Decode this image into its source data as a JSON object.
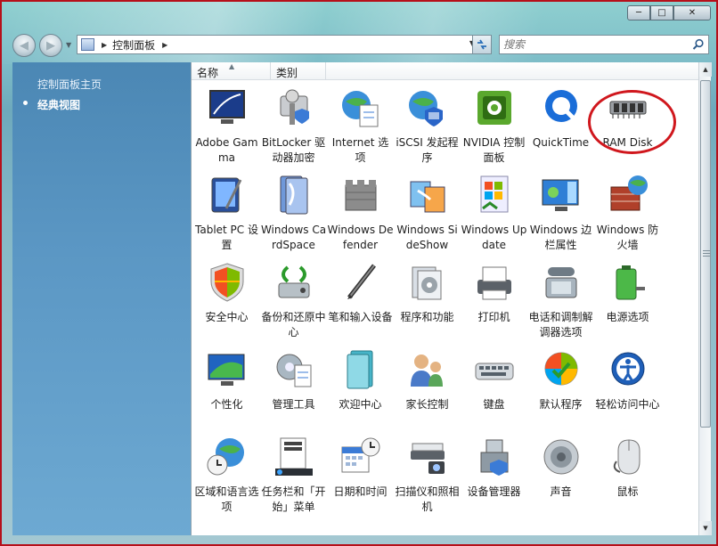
{
  "window": {
    "caption": {
      "minimize": "─",
      "maximize": "□",
      "close": "✕"
    }
  },
  "nav": {
    "back": "◀",
    "forward": "▶",
    "address_path": "控制面板",
    "search_placeholder": "搜索"
  },
  "sidebar": {
    "home_link": "控制面板主页",
    "classic_view": "经典视图"
  },
  "columns": {
    "name": "名称",
    "type": "类别"
  },
  "items": [
    {
      "label": "Adobe Gamma",
      "icon": "monitor-icon"
    },
    {
      "label": "BitLocker 驱动器加密",
      "icon": "bitlocker-key-icon"
    },
    {
      "label": "Internet 选项",
      "icon": "globe-doc-icon"
    },
    {
      "label": "iSCSI 发起程序",
      "icon": "globe-shield-icon"
    },
    {
      "label": "NVIDIA 控制面板",
      "icon": "nvidia-icon"
    },
    {
      "label": "QuickTime",
      "icon": "quicktime-icon"
    },
    {
      "label": "RAM Disk",
      "icon": "ram-chip-icon"
    },
    {
      "label": "Tablet PC 设置",
      "icon": "tablet-pc-icon"
    },
    {
      "label": "Windows CardSpace",
      "icon": "cardspace-icon"
    },
    {
      "label": "Windows Defender",
      "icon": "defender-castle-icon"
    },
    {
      "label": "Windows SideShow",
      "icon": "sideshow-icon"
    },
    {
      "label": "Windows Update",
      "icon": "windows-update-icon"
    },
    {
      "label": "Windows 边栏属性",
      "icon": "sidebar-properties-icon"
    },
    {
      "label": "Windows 防火墙",
      "icon": "firewall-icon"
    },
    {
      "label": "安全中心",
      "icon": "security-shield-icon"
    },
    {
      "label": "备份和还原中心",
      "icon": "backup-icon"
    },
    {
      "label": "笔和输入设备",
      "icon": "pen-icon"
    },
    {
      "label": "程序和功能",
      "icon": "programs-icon"
    },
    {
      "label": "打印机",
      "icon": "printer-icon"
    },
    {
      "label": "电话和调制解调器选项",
      "icon": "phone-icon"
    },
    {
      "label": "电源选项",
      "icon": "battery-icon"
    },
    {
      "label": "个性化",
      "icon": "personalize-monitor-icon"
    },
    {
      "label": "管理工具",
      "icon": "admin-tools-icon"
    },
    {
      "label": "欢迎中心",
      "icon": "welcome-center-icon"
    },
    {
      "label": "家长控制",
      "icon": "parental-controls-icon"
    },
    {
      "label": "键盘",
      "icon": "keyboard-icon"
    },
    {
      "label": "默认程序",
      "icon": "default-programs-icon"
    },
    {
      "label": "轻松访问中心",
      "icon": "ease-of-access-icon"
    },
    {
      "label": "区域和语言选项",
      "icon": "globe-clock-icon"
    },
    {
      "label": "任务栏和「开始」菜单",
      "icon": "taskbar-icon"
    },
    {
      "label": "日期和时间",
      "icon": "calendar-clock-icon"
    },
    {
      "label": "扫描仪和照相机",
      "icon": "scanner-icon"
    },
    {
      "label": "设备管理器",
      "icon": "device-manager-icon"
    },
    {
      "label": "声音",
      "icon": "speaker-icon"
    },
    {
      "label": "鼠标",
      "icon": "mouse-icon"
    }
  ],
  "colors": {
    "highlight_ring": "#d0171d",
    "window_border": "#b6101a"
  }
}
